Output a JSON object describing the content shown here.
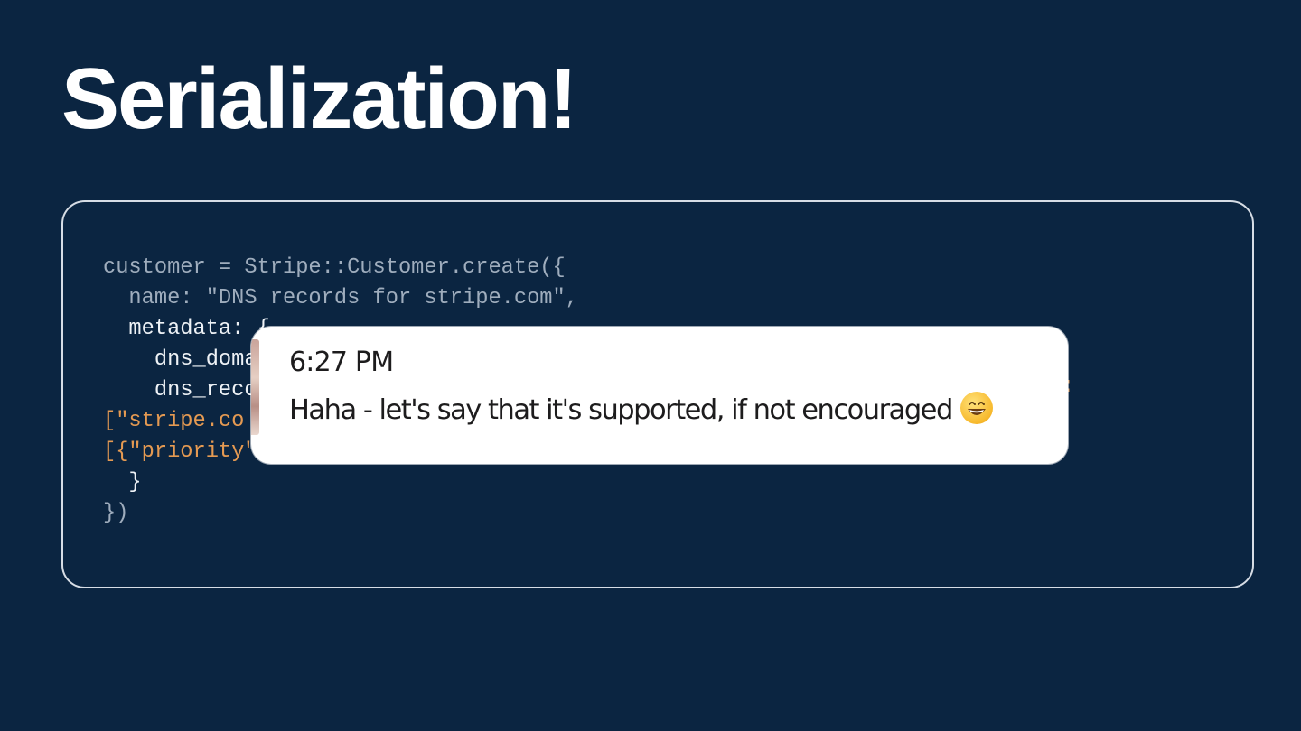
{
  "slide": {
    "title": "Serialization!"
  },
  "code": {
    "lines": [
      "customer = Stripe::Customer.create({",
      "  name: \"DNS records for stripe.com\",",
      "  metadata: {",
      "    dns_doma",
      "    dns_reco",
      "[\"stripe.co",
      "[{\"priority\"",
      "  }",
      "})"
    ],
    "right_fragment": ":"
  },
  "chat": {
    "time": "6:27 PM",
    "message": "Haha - let's say that it's supported, if not encouraged",
    "emoji_icon": "grinning-face-icon"
  },
  "colors": {
    "background": "#0b2541",
    "code_dim": "#9fadbd",
    "code_bright": "#eef2f6",
    "code_accent": "#e59a52"
  }
}
